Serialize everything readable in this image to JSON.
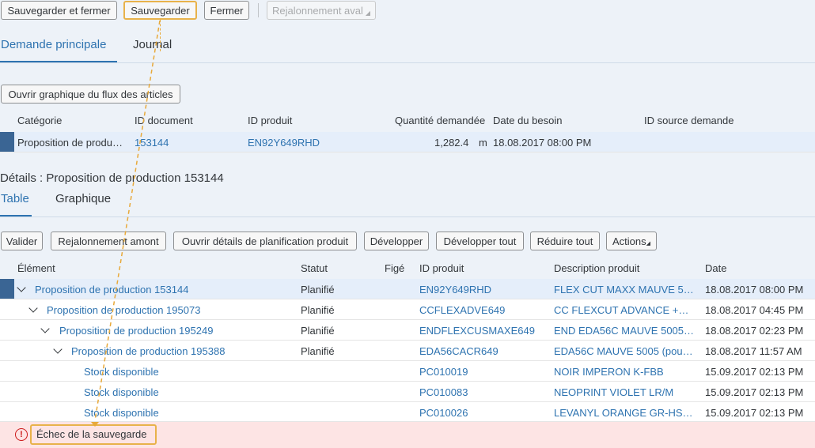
{
  "toolbar": {
    "save_close": "Sauvegarder et fermer",
    "save": "Sauvegarder",
    "close": "Fermer",
    "reschedule_down": "Rejalonnement aval"
  },
  "tabs": {
    "main": "Demande principale",
    "journal": "Journal"
  },
  "flow_button": "Ouvrir graphique du flux des articles",
  "demand_table": {
    "headers": [
      "Catégorie",
      "ID document",
      "ID produit",
      "Quantité demandée",
      "Date du besoin",
      "ID source demande"
    ],
    "row": {
      "category": "Proposition de produ…",
      "doc_id": "153144",
      "product_id": "EN92Y649RHD",
      "quantity": "1,282.4",
      "unit": "m",
      "date": "18.08.2017 08:00 PM",
      "source": ""
    }
  },
  "details": {
    "title": "Détails : Proposition de production 153144",
    "tabs": {
      "table": "Table",
      "graphic": "Graphique"
    },
    "actions": [
      "Valider",
      "Rejalonnement amont",
      "Ouvrir détails de planification produit",
      "Développer",
      "Développer tout",
      "Réduire tout",
      "Actions"
    ],
    "headers": [
      "Élément",
      "Statut",
      "Figé",
      "ID produit",
      "Description produit",
      "Date"
    ],
    "rows": [
      {
        "element": "Proposition de production 153144",
        "status": "Planifié",
        "product": "EN92Y649RHD",
        "desc": "FLEX CUT MAXX MAUVE 5…",
        "date": "18.08.2017 08:00 PM"
      },
      {
        "element": "Proposition de production 195073",
        "status": "Planifié",
        "product": "CCFLEXADVE649",
        "desc": "CC FLEXCUT ADVANCE +…",
        "date": "18.08.2017 04:45 PM"
      },
      {
        "element": "Proposition de production 195249",
        "status": "Planifié",
        "product": "ENDFLEXCUSMAXE649",
        "desc": "END EDA56C MAUVE 5005…",
        "date": "18.08.2017 02:23 PM"
      },
      {
        "element": "Proposition de production 195388",
        "status": "Planifié",
        "product": "EDA56CACR649",
        "desc": "EDA56C MAUVE 5005 (pou…",
        "date": "18.08.2017 11:57 AM"
      },
      {
        "element": "Stock disponible",
        "status": "",
        "product": "PC010019",
        "desc": "NOIR IMPERON K-FBB",
        "date": "15.09.2017 02:13 PM"
      },
      {
        "element": "Stock disponible",
        "status": "",
        "product": "PC010083",
        "desc": "NEOPRINT VIOLET LR/M",
        "date": "15.09.2017 02:13 PM"
      },
      {
        "element": "Stock disponible",
        "status": "",
        "product": "PC010026",
        "desc": "LEVANYL ORANGE GR-HS…",
        "date": "15.09.2017 02:13 PM"
      }
    ]
  },
  "message": "Échec de la sauvegarde",
  "icons": {
    "error": "error-icon",
    "expand": "chevron-down-icon"
  },
  "colors": {
    "accent": "#2e73b0",
    "highlight": "#e8b24a",
    "error": "#cc1919"
  }
}
